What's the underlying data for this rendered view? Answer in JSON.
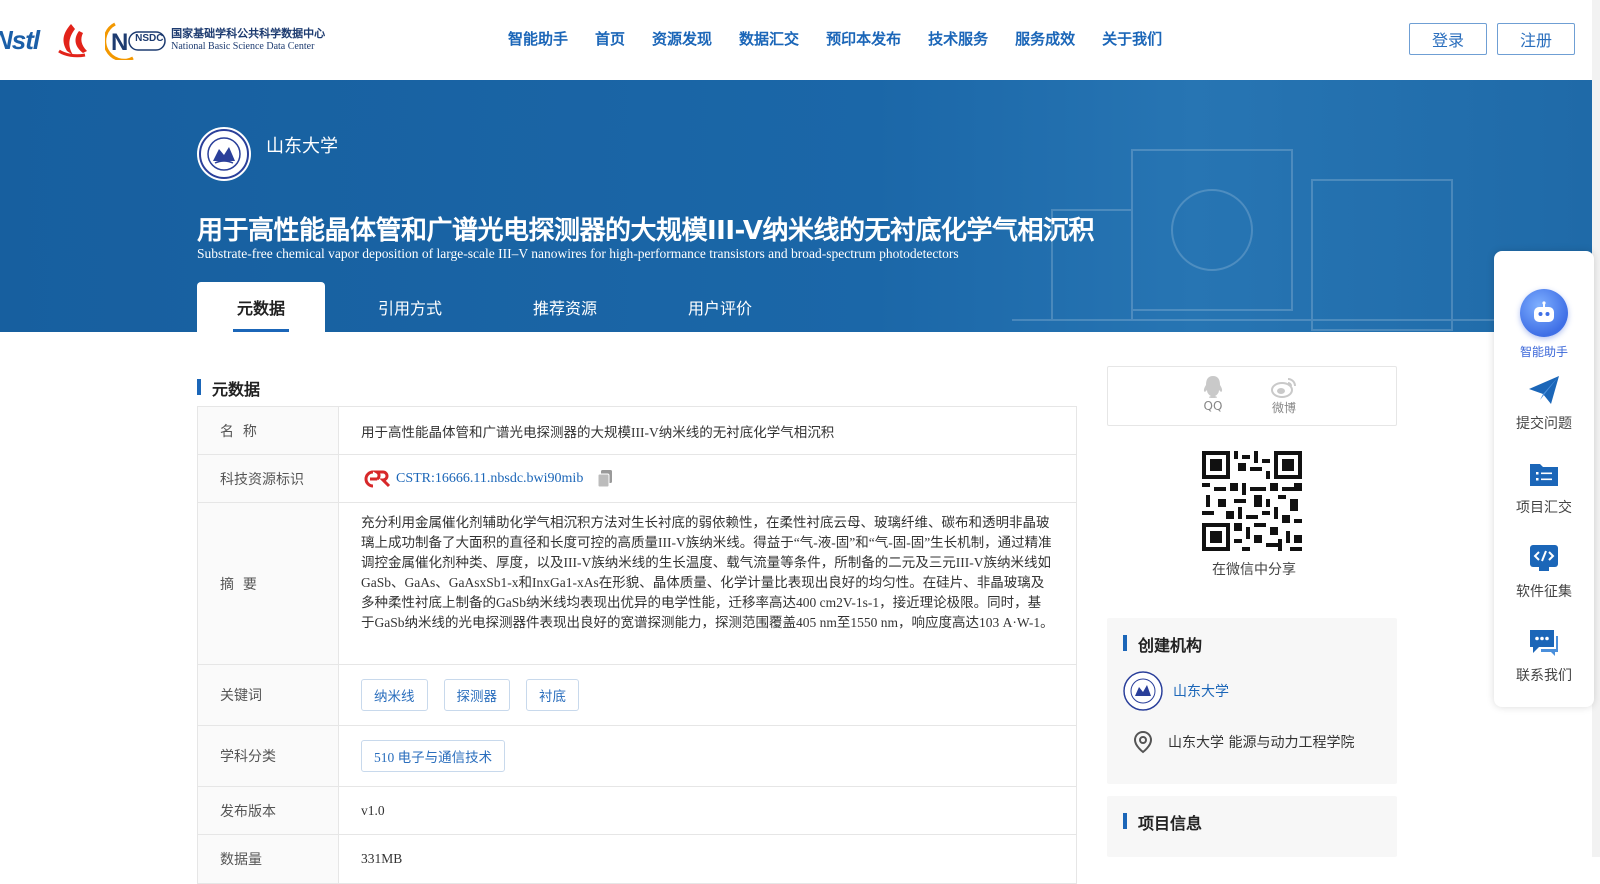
{
  "header": {
    "logo_nstl": "Nstl",
    "logo_nsdc_cn": "国家基础学科公共科学数据中心",
    "logo_nsdc_en": "National Basic Science Data Center",
    "logo_nsdc_badge": "NSDC",
    "nav": [
      "智能助手",
      "首页",
      "资源发现",
      "数据汇交",
      "预印本发布",
      "技术服务",
      "服务成效",
      "关于我们"
    ],
    "login": "登录",
    "register": "注册"
  },
  "banner": {
    "institution": "山东大学",
    "title_cn": "用于高性能晶体管和广谱光电探测器的大规模III-V纳米线的无衬底化学气相沉积",
    "title_en": "Substrate-free chemical vapor deposition of large-scale III–V nanowires for high-performance transistors and broad-spectrum photodetectors",
    "tabs": [
      "元数据",
      "引用方式",
      "推荐资源",
      "用户评价"
    ]
  },
  "metadata": {
    "section_title": "元数据",
    "rows": {
      "name_label": "名  称",
      "name_value": "用于高性能晶体管和广谱光电探测器的大规模III-V纳米线的无衬底化学气相沉积",
      "id_label": "科技资源标识",
      "id_value": "CSTR:16666.11.nbsdc.bwi90mib",
      "abstract_label": "摘  要",
      "abstract_value": "充分利用金属催化剂辅助化学气相沉积方法对生长衬底的弱依赖性，在柔性衬底云母、玻璃纤维、碳布和透明非晶玻璃上成功制备了大面积的直径和长度可控的高质量III-V族纳米线。得益于“气-液-固”和“气-固-固”生长机制，通过精准调控金属催化剂种类、厚度，以及III-V族纳米线的生长温度、载气流量等条件，所制备的二元及三元III-V族纳米线如GaSb、GaAs、GaAsxSb1-x和InxGa1-xAs在形貌、晶体质量、化学计量比表现出良好的均匀性。在硅片、非晶玻璃及多种柔性衬底上制备的GaSb纳米线均表现出优异的电学性能，迁移率高达400 cm2V-1s-1，接近理论极限。同时，基于GaSb纳米线的光电探测器件表现出良好的宽谱探测能力，探测范围覆盖405 nm至1550 nm，响应度高达103 A·W-1。",
      "keywords_label": "关键词",
      "keywords": [
        "纳米线",
        "探测器",
        "衬底"
      ],
      "subject_label": "学科分类",
      "subject": "510 电子与通信技术",
      "version_label": "发布版本",
      "version": "v1.0",
      "size_label": "数据量",
      "size": "331MB"
    }
  },
  "share": {
    "qq": "QQ",
    "weibo": "微博",
    "wechat": "在微信中分享"
  },
  "creator": {
    "title": "创建机构",
    "institution": "山东大学",
    "location": "山东大学 能源与动力工程学院"
  },
  "project": {
    "title": "项目信息"
  },
  "sidebar": {
    "items": [
      "智能助手",
      "提交问题",
      "项目汇交",
      "软件征集",
      "联系我们"
    ]
  },
  "colors": {
    "primary": "#1b66b8",
    "banner": "#1b67a8"
  }
}
